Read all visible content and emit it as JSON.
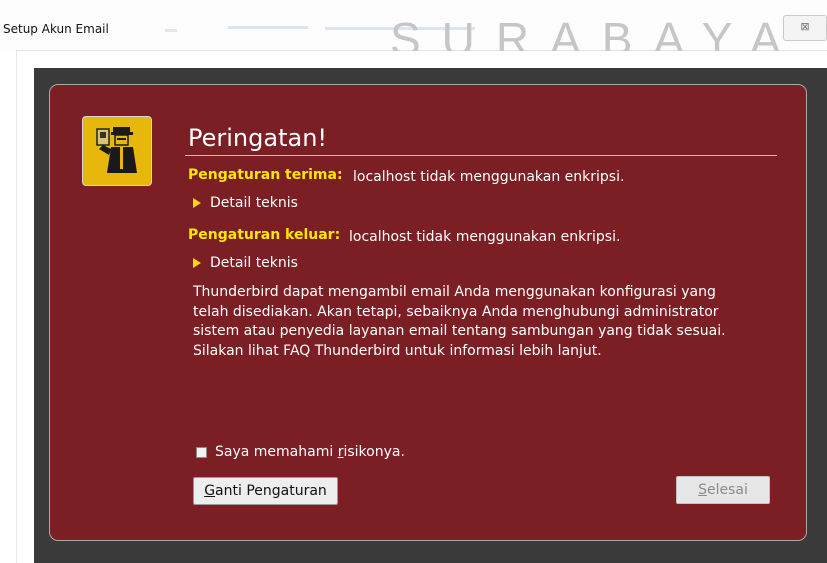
{
  "window": {
    "title": "Setup Akun Email",
    "close_icon": "close-icon",
    "close_glyph": "⊠"
  },
  "watermark": "SURABAYA",
  "warning_icon": "security-officer-icon",
  "dialog": {
    "heading": "Peringatan!",
    "incoming": {
      "label": "Pengaturan terima:",
      "text": "localhost tidak menggunakan enkripsi.",
      "details": "Detail teknis"
    },
    "outgoing": {
      "label": "Pengaturan keluar:",
      "text": "localhost tidak menggunakan enkripsi.",
      "details": "Detail teknis"
    },
    "paragraph_lines": [
      "Thunderbird dapat mengambil email Anda menggunakan konfigurasi yang",
      "telah disediakan. Akan tetapi, sebaiknya Anda menghubungi administrator",
      "sistem atau penyedia layanan email tentang sambungan yang tidak sesuai.",
      "Silakan lihat FAQ Thunderbird untuk informasi lebih lanjut."
    ],
    "checkbox": {
      "label_before": "Saya memahami ",
      "label_accel": "r",
      "label_after": "isikonya.",
      "checked": false
    },
    "buttons": {
      "change_accel": "G",
      "change_rest": "anti Pengaturan",
      "done_accel": "S",
      "done_rest": "elesai",
      "done_enabled": false
    }
  },
  "colors": {
    "dialog_bg": "#7b1f24",
    "label_yellow": "#ffe700",
    "icon_yellow": "#e8b70b"
  }
}
